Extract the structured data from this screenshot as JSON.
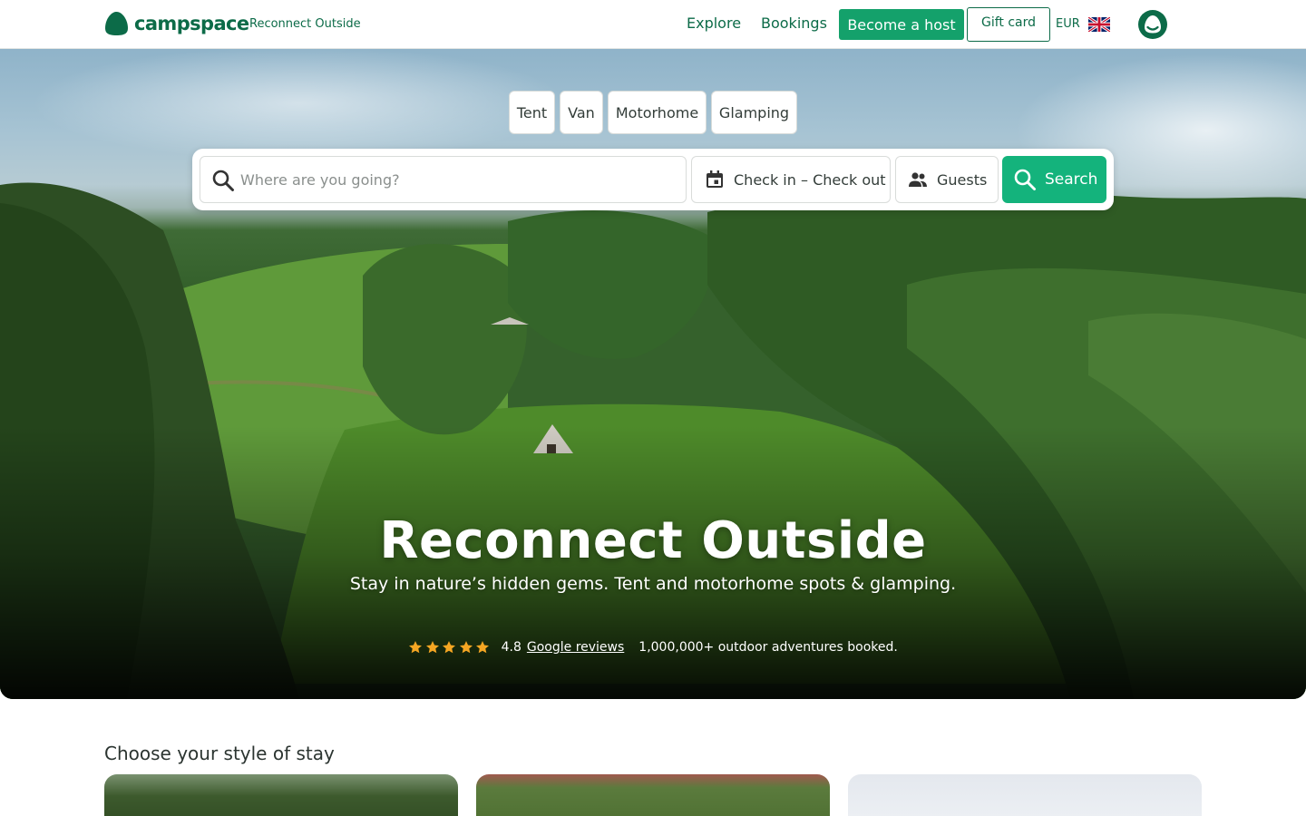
{
  "header": {
    "brand": "campspace",
    "tagline": "Reconnect Outside",
    "nav": {
      "explore": "Explore",
      "bookings": "Bookings",
      "become_host": "Become a host",
      "gift_card": "Gift card"
    },
    "currency": "EUR",
    "language_flag_icon": "uk-flag-icon",
    "avatar_icon": "user-avatar-icon"
  },
  "hero": {
    "stay_types": [
      "Tent",
      "Van",
      "Motorhome",
      "Glamping"
    ],
    "search": {
      "placeholder": "Where are you going?",
      "dates_label": "Check in – Check out",
      "guests_label": "Guests",
      "button_label": "Search"
    },
    "title": "Reconnect Outside",
    "subtitle": "Stay in nature’s hidden gems. Tent and motorhome spots & glamping.",
    "rating": {
      "stars": 5,
      "value": "4.8",
      "link_text": "Google reviews",
      "bookings_text": "1,000,000+ outdoor adventures booked."
    }
  },
  "section": {
    "title": "Choose your style of stay"
  },
  "colors": {
    "brand_green": "#0c6b48",
    "host_button": "#14a16b",
    "search_button": "#14b37c",
    "star": "#f5a623"
  }
}
